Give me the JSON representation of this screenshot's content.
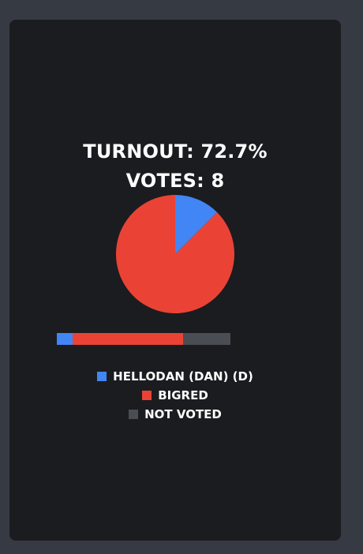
{
  "turnout": {
    "label": "TURNOUT:",
    "value": "72.7%"
  },
  "votes": {
    "label": "VOTES:",
    "value": "8"
  },
  "colors": {
    "hellodan": "#4285f4",
    "bigred": "#ea4335",
    "not_voted": "#4a4e54"
  },
  "chart_data": {
    "type": "pie",
    "series": [
      {
        "name": "HELLODAN (DAN) (D)",
        "value": 1,
        "color": "#4285f4"
      },
      {
        "name": "BIGRED",
        "value": 7,
        "color": "#ea4335"
      }
    ],
    "bar": [
      {
        "name": "HELLODAN (DAN) (D)",
        "value": 1,
        "color": "#4285f4"
      },
      {
        "name": "BIGRED",
        "value": 7,
        "color": "#ea4335"
      },
      {
        "name": "NOT VOTED",
        "value": 3,
        "color": "#4a4e54"
      }
    ]
  },
  "legend": [
    {
      "label": "HELLODAN (DAN) (D)",
      "color": "#4285f4"
    },
    {
      "label": "BIGRED",
      "color": "#ea4335"
    },
    {
      "label": "NOT VOTED",
      "color": "#4a4e54"
    }
  ]
}
